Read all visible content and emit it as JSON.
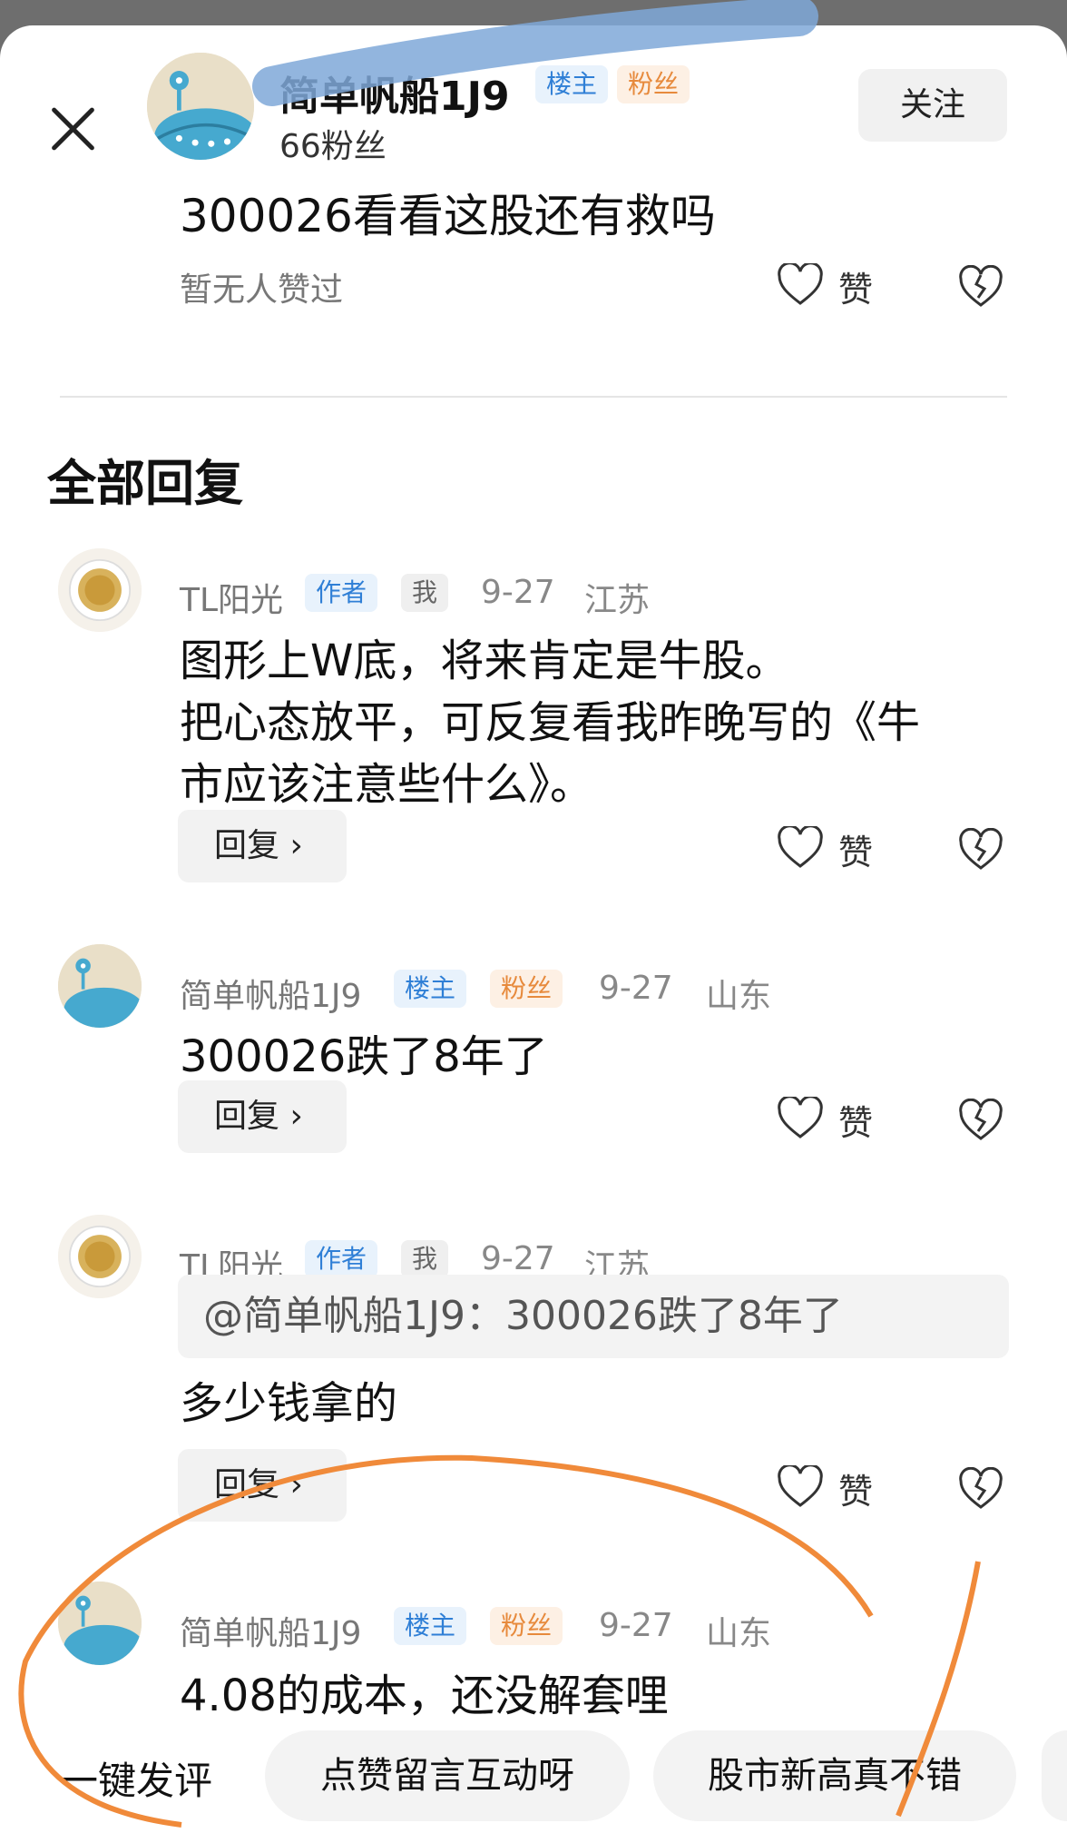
{
  "header": {
    "author_name": "简单帆船1J9",
    "tag_owner": "楼主",
    "tag_fan": "粉丝",
    "fans": "66粉丝",
    "follow": "关注"
  },
  "post": {
    "text": "300026看看这股还有救吗",
    "no_likes": "暂无人赞过",
    "like": "赞"
  },
  "section_title": "全部回复",
  "replies": [
    {
      "name": "TL阳光",
      "tag1": "作者",
      "tag2": "我",
      "date": "9-27",
      "region": "江苏",
      "lines": [
        "图形上W底，将来肯定是牛股。",
        "把心态放平，可反复看我昨晚写的《牛",
        "市应该注意些什么》。"
      ],
      "reply": "回复",
      "like": "赞"
    },
    {
      "name": "简单帆船1J9",
      "tag1": "楼主",
      "tag2": "粉丝",
      "date": "9-27",
      "region": "山东",
      "lines": [
        "300026跌了8年了"
      ],
      "reply": "回复",
      "like": "赞"
    },
    {
      "name": "TL阳光",
      "tag1": "作者",
      "tag2": "我",
      "date": "9-27",
      "region": "江苏",
      "quote": "@简单帆船1J9：300026跌了8年了",
      "lines": [
        "多少钱拿的"
      ],
      "reply": "回复",
      "like": "赞"
    },
    {
      "name": "简单帆船1J9",
      "tag1": "楼主",
      "tag2": "粉丝",
      "date": "9-27",
      "region": "山东",
      "lines": [
        "4.08的成本，还没解套哩"
      ]
    }
  ],
  "quick_bar": {
    "label": "一键发评",
    "chips": [
      "点赞留言互动呀",
      "股市新高真不错"
    ]
  },
  "colors": {
    "tag_blue": "#2f7fd6",
    "tag_orange": "#e78a3c",
    "annotation_orange": "#f08a3a",
    "scribble_blue": "#7fa8d8"
  }
}
